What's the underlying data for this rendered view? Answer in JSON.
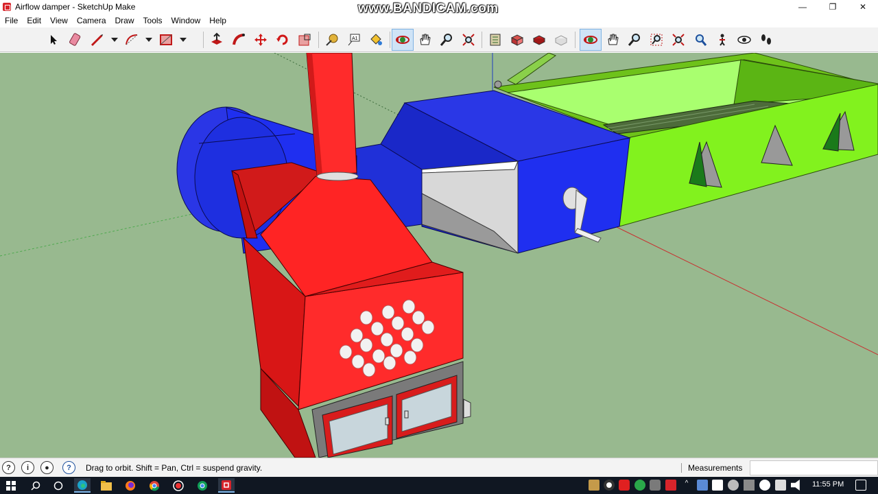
{
  "window": {
    "title": "Airflow damper - SketchUp Make",
    "watermark": "www.BANDICAM.com",
    "controls": {
      "minimize": "—",
      "maximize": "❐",
      "close": "✕"
    }
  },
  "menu": [
    "File",
    "Edit",
    "View",
    "Camera",
    "Draw",
    "Tools",
    "Window",
    "Help"
  ],
  "toolbar": {
    "tools": [
      "select-tool",
      "eraser-tool",
      "line-tool",
      "arc-tool",
      "rectangle-tool",
      "push-pull-tool",
      "follow-me-tool",
      "move-tool",
      "rotate-tool",
      "scale-tool",
      "tape-measure-tool",
      "text-tool",
      "paint-bucket-tool",
      "orbit-tool",
      "pan-tool",
      "zoom-tool",
      "zoom-extents-tool",
      "warehouse-tool",
      "extension-warehouse-tool",
      "layout-tool",
      "share-tool",
      "orbit-tool-2",
      "pan-tool-2",
      "zoom-tool-2",
      "zoom-window-tool",
      "zoom-extents-tool-2",
      "previous-view-tool",
      "position-camera-tool",
      "look-around-tool",
      "walk-tool"
    ],
    "active_tool": "orbit-tool"
  },
  "status": {
    "hint": "Drag to orbit. Shift = Pan, Ctrl = suspend gravity.",
    "measurements_label": "Measurements",
    "measurements_value": ""
  },
  "taskbar": {
    "apps": [
      "start-icon",
      "search-icon",
      "task-view-icon",
      "edge-icon",
      "file-explorer-icon",
      "firefox-icon",
      "chrome-icon",
      "record-icon",
      "chrome-2-icon",
      "sketchup-icon"
    ],
    "clock": "11:55 PM"
  },
  "colors": {
    "viewport_bg": "#98b98f",
    "stove_red": "#ff2626",
    "duct_blue": "#1f2ff0",
    "dryer_green": "#82f21e",
    "accent": "#1c4f9c"
  }
}
